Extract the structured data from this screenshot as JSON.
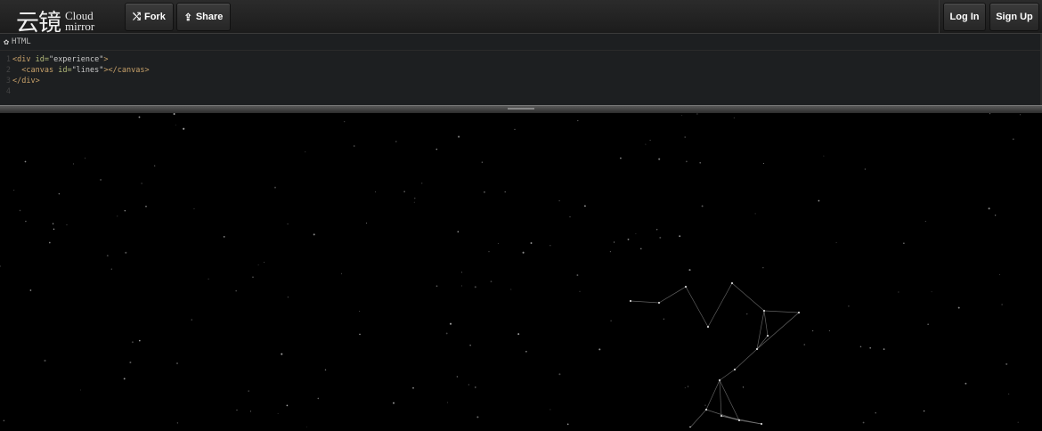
{
  "header": {
    "logo_mark": "云镜",
    "logo_line1": "Cloud",
    "logo_line2": "mirror",
    "fork_label": "Fork",
    "share_label": "Share",
    "login_label": "Log In",
    "signup_label": "Sign Up"
  },
  "editor": {
    "panel_label": "HTML",
    "lines": [
      {
        "n": "1",
        "indent": "",
        "tag_open": "<div ",
        "attr": "id=",
        "str": "\"experience\"",
        "tag_close": ">"
      },
      {
        "n": "2",
        "indent": "  ",
        "tag_open": "<canvas ",
        "attr": "id=",
        "str": "\"lines\"",
        "tag_close": "></canvas>"
      },
      {
        "n": "3",
        "indent": "",
        "tag_open": "</div>",
        "attr": "",
        "str": "",
        "tag_close": ""
      },
      {
        "n": "4",
        "indent": "",
        "tag_open": "",
        "attr": "",
        "str": "",
        "tag_close": ""
      }
    ]
  },
  "icons": {
    "fork": "fork-icon",
    "share": "share-icon",
    "settings": "gear-icon"
  }
}
